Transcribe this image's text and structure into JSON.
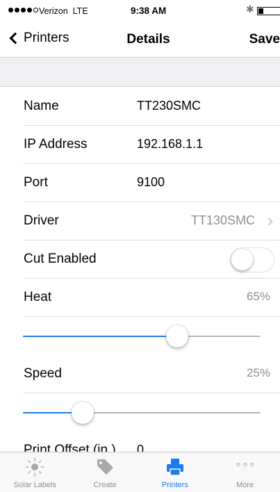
{
  "status_bar": {
    "carrier": "Verizon",
    "network": "LTE",
    "time": "9:38 AM",
    "signal_bars": 4,
    "signal_total": 5,
    "battery_level": 0.15
  },
  "nav": {
    "back_label": "Printers",
    "title": "Details",
    "save_label": "Save"
  },
  "fields": {
    "name": {
      "label": "Name",
      "value": "TT230SMC"
    },
    "ip_address": {
      "label": "IP Address",
      "value": "192.168.1.1"
    },
    "port": {
      "label": "Port",
      "value": "9100"
    },
    "driver": {
      "label": "Driver",
      "value": "TT130SMC"
    },
    "cut_enabled": {
      "label": "Cut Enabled",
      "value": false
    },
    "heat": {
      "label": "Heat",
      "value_text": "65%",
      "level": 0.65
    },
    "speed": {
      "label": "Speed",
      "value_text": "25%",
      "level": 0.25
    },
    "print_offset": {
      "label": "Print Offset (in.)",
      "value": "0"
    }
  },
  "tab_bar": {
    "tabs": [
      {
        "label": "Solar Labels",
        "icon": "sun-icon",
        "active": false
      },
      {
        "label": "Create",
        "icon": "tag-icon",
        "active": false
      },
      {
        "label": "Printers",
        "icon": "printer-icon",
        "active": true
      },
      {
        "label": "More",
        "icon": "more-dots-icon",
        "active": false
      }
    ]
  },
  "colors": {
    "accent": "#1a7bf0",
    "secondary_text": "#8e8e93",
    "group_background": "#efeff4"
  }
}
